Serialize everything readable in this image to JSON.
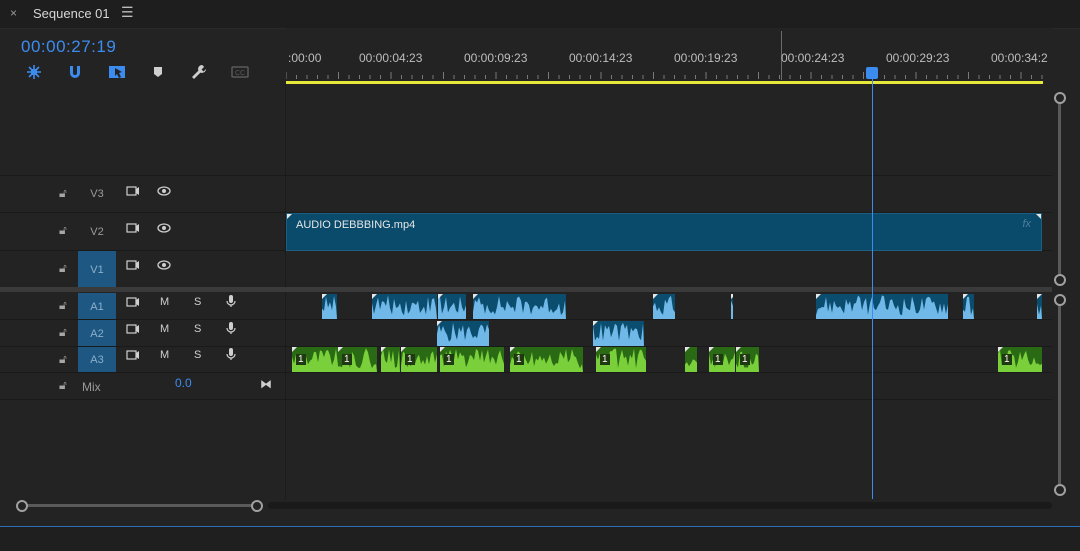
{
  "tab": {
    "title": "Sequence 01",
    "close_glyph": "×",
    "menu_glyph": "☰"
  },
  "timecode": "00:00:27:19",
  "tools": [
    {
      "name": "nest-sequence-icon"
    },
    {
      "name": "snap-icon"
    },
    {
      "name": "linked-selection-icon"
    },
    {
      "name": "add-marker-icon"
    },
    {
      "name": "wrench-icon"
    },
    {
      "name": "captions-icon"
    }
  ],
  "ruler": {
    "labels": [
      ":00:00",
      "00:00:04:23",
      "00:00:09:23",
      "00:00:14:23",
      "00:00:19:23",
      "00:00:24:23",
      "00:00:29:23",
      "00:00:34:2"
    ]
  },
  "playhead_time": "00:00:27:19",
  "tracks": {
    "video": [
      {
        "id": "V3",
        "selected": false
      },
      {
        "id": "V2",
        "selected": false
      },
      {
        "id": "V1",
        "selected": true
      }
    ],
    "audio": [
      {
        "id": "A1",
        "selected": true,
        "m": "M",
        "s": "S"
      },
      {
        "id": "A2",
        "selected": true,
        "m": "M",
        "s": "S"
      },
      {
        "id": "A3",
        "selected": true,
        "m": "M",
        "s": "S"
      }
    ],
    "mix": {
      "label": "Mix",
      "value": "0.0"
    }
  },
  "video_clip": {
    "name": "AUDIO DEBBBING.mp4",
    "fx": "fx"
  },
  "a3_clip_label": "1",
  "colors": {
    "accent": "#3c8cf0",
    "video_clip": "#0a4a6a",
    "audio_clip": "#0b4d6e",
    "audio_wave": "#6fb8e8",
    "a3_clip": "#2a6a14",
    "a3_wave": "#7ad03a",
    "work_area": "#e8e83a"
  }
}
